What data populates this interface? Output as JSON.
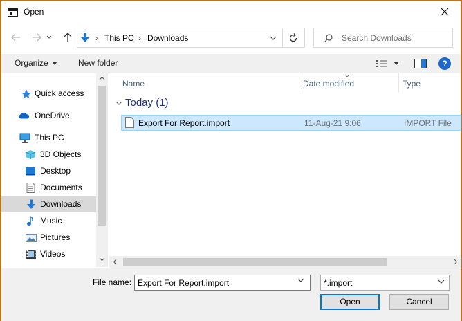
{
  "window": {
    "title": "Open"
  },
  "address": {
    "crumbs": [
      "This PC",
      "Downloads"
    ]
  },
  "search": {
    "placeholder": "Search Downloads"
  },
  "toolbar": {
    "organize": "Organize",
    "new_folder": "New folder"
  },
  "navpane": {
    "items": [
      {
        "label": "Quick access",
        "icon": "star-icon"
      },
      {
        "label": "OneDrive",
        "icon": "cloud-icon"
      },
      {
        "label": "This PC",
        "icon": "computer-icon"
      },
      {
        "label": "3D Objects",
        "icon": "cube-icon"
      },
      {
        "label": "Desktop",
        "icon": "desktop-icon"
      },
      {
        "label": "Documents",
        "icon": "document-icon"
      },
      {
        "label": "Downloads",
        "icon": "download-icon",
        "selected": true
      },
      {
        "label": "Music",
        "icon": "music-icon"
      },
      {
        "label": "Pictures",
        "icon": "picture-icon"
      },
      {
        "label": "Videos",
        "icon": "video-icon"
      }
    ]
  },
  "filelist": {
    "columns": [
      "Name",
      "Date modified",
      "Type"
    ],
    "group": "Today (1)",
    "rows": [
      {
        "name": "Export For Report.import",
        "date": "11-Aug-21 9:06",
        "type": "IMPORT File"
      }
    ]
  },
  "bottom": {
    "file_name_label": "File name:",
    "file_name_value": "Export For Report.import",
    "filter_value": "*.import",
    "open_label": "Open",
    "cancel_label": "Cancel"
  },
  "colors": {
    "accent": "#0078d7",
    "selection": "#cce8ff",
    "window_border": "#b5761e",
    "help": "#1e68c9"
  }
}
